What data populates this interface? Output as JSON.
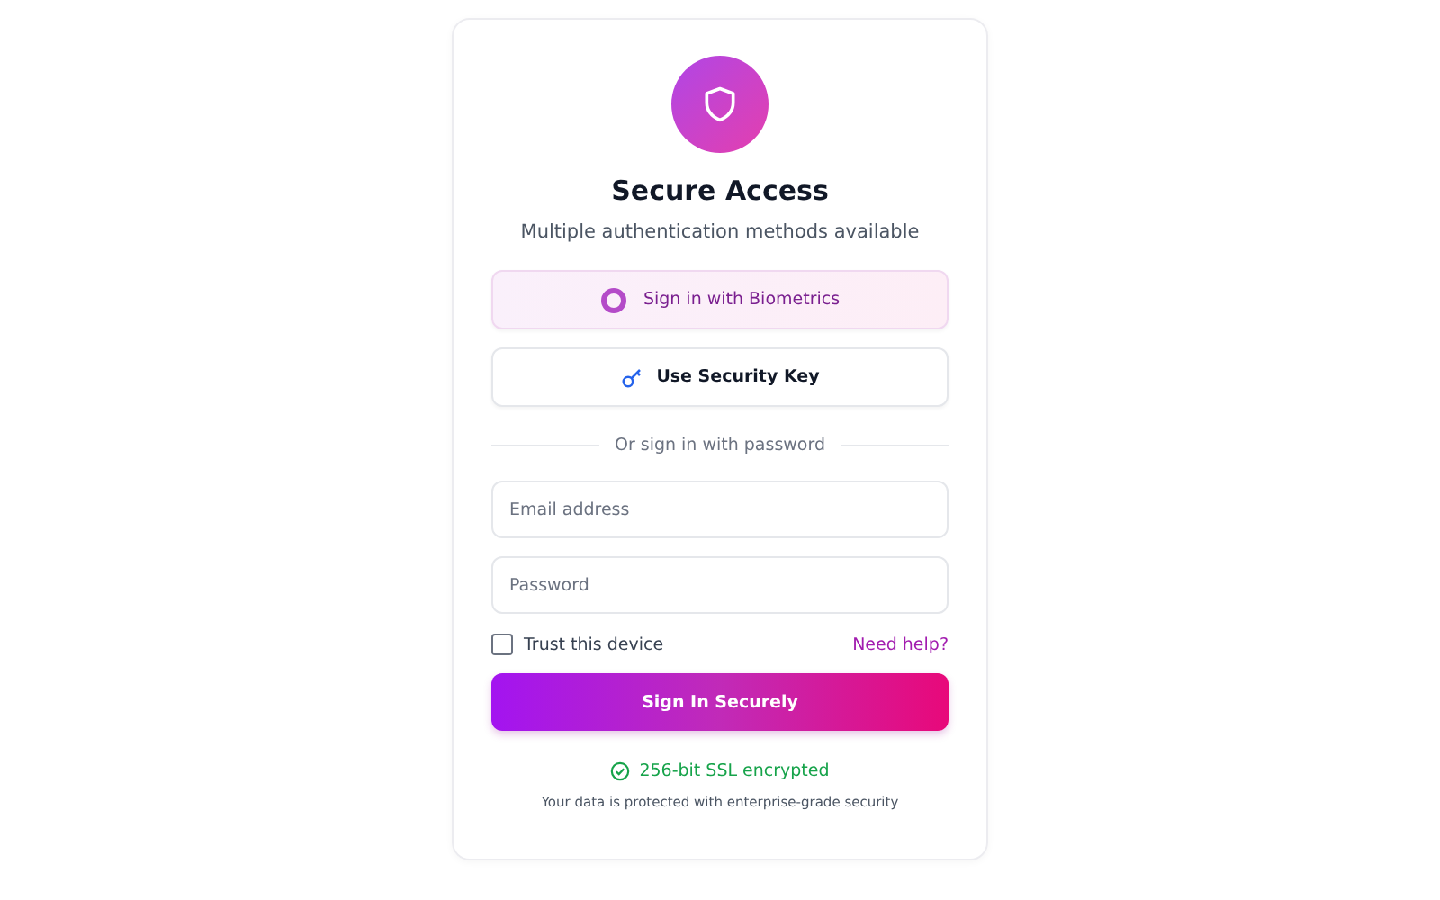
{
  "title": "Secure Access",
  "subtitle": "Multiple authentication methods available",
  "methods": [
    {
      "kind": "biometric",
      "label": "Sign in with Biometrics",
      "selected": true
    },
    {
      "kind": "key",
      "label": "Use Security Key",
      "selected": false
    }
  ],
  "divider": "Or sign in with password",
  "fields": [
    {
      "placeholder": "Email address"
    },
    {
      "placeholder": "Password"
    }
  ],
  "trust": {
    "label": "Trust this device",
    "checked": false
  },
  "help_link": "Need help?",
  "submit": "Sign In Securely",
  "ssl": "256-bit SSL encrypted",
  "footer": "Your data is protected with enterprise-grade security"
}
